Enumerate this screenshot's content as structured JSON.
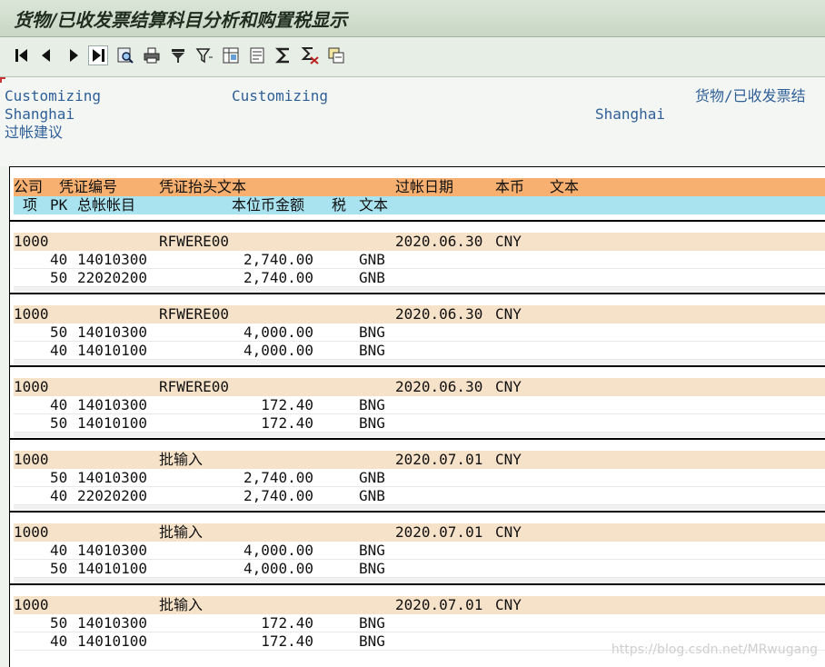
{
  "window": {
    "title": "货物/已收发票结算科目分析和购置税显示"
  },
  "toolbar": {
    "buttons": [
      {
        "icon": "first-page-icon"
      },
      {
        "icon": "previous-page-icon"
      },
      {
        "icon": "next-page-icon"
      },
      {
        "icon": "last-page-icon"
      },
      {
        "icon": "find-icon"
      },
      {
        "icon": "print-icon"
      },
      {
        "icon": "filter-icon"
      },
      {
        "icon": "funnel-icon"
      },
      {
        "icon": "choose-layout-icon"
      },
      {
        "icon": "save-layout-icon"
      },
      {
        "icon": "sum-icon"
      },
      {
        "icon": "subtotal-icon"
      },
      {
        "icon": "export-icon"
      }
    ]
  },
  "header": {
    "line1_left": "Customizing",
    "line1_mid": "Customizing",
    "line1_right": "货物/已收发票结",
    "line2_left": "Shanghai",
    "line2_right": "Shanghai",
    "line3_left": "过帐建议"
  },
  "columns": {
    "h1": {
      "company": "公司",
      "doc_no": "凭证编号",
      "header_text": "凭证抬头文本",
      "posting_date": "过帐日期",
      "currency": "本币",
      "text": "文本"
    },
    "h2": {
      "item": "项",
      "pk": "PK",
      "gl_account": "总帐帐目",
      "amount": "本位币金额",
      "tax": "税",
      "text": "文本"
    }
  },
  "documents": [
    {
      "company": "1000",
      "doc_no": "",
      "header_text": "RFWERE00",
      "posting_date": "2020.06.30",
      "currency": "CNY",
      "lines": [
        {
          "pk": "40",
          "account": "14010300",
          "amount": "2,740.00",
          "tax": "GNB"
        },
        {
          "pk": "50",
          "account": "22020200",
          "amount": "2,740.00",
          "tax": "GNB"
        }
      ]
    },
    {
      "company": "1000",
      "doc_no": "",
      "header_text": "RFWERE00",
      "posting_date": "2020.06.30",
      "currency": "CNY",
      "lines": [
        {
          "pk": "50",
          "account": "14010300",
          "amount": "4,000.00",
          "tax": "BNG"
        },
        {
          "pk": "40",
          "account": "14010100",
          "amount": "4,000.00",
          "tax": "BNG"
        }
      ]
    },
    {
      "company": "1000",
      "doc_no": "",
      "header_text": "RFWERE00",
      "posting_date": "2020.06.30",
      "currency": "CNY",
      "lines": [
        {
          "pk": "40",
          "account": "14010300",
          "amount": "172.40",
          "tax": "BNG"
        },
        {
          "pk": "50",
          "account": "14010100",
          "amount": "172.40",
          "tax": "BNG"
        }
      ]
    },
    {
      "company": "1000",
      "doc_no": "",
      "header_text": "批输入",
      "posting_date": "2020.07.01",
      "currency": "CNY",
      "lines": [
        {
          "pk": "50",
          "account": "14010300",
          "amount": "2,740.00",
          "tax": "GNB"
        },
        {
          "pk": "40",
          "account": "22020200",
          "amount": "2,740.00",
          "tax": "GNB"
        }
      ]
    },
    {
      "company": "1000",
      "doc_no": "",
      "header_text": "批输入",
      "posting_date": "2020.07.01",
      "currency": "CNY",
      "lines": [
        {
          "pk": "40",
          "account": "14010300",
          "amount": "4,000.00",
          "tax": "BNG"
        },
        {
          "pk": "50",
          "account": "14010100",
          "amount": "4,000.00",
          "tax": "BNG"
        }
      ]
    },
    {
      "company": "1000",
      "doc_no": "",
      "header_text": "批输入",
      "posting_date": "2020.07.01",
      "currency": "CNY",
      "lines": [
        {
          "pk": "50",
          "account": "14010300",
          "amount": "172.40",
          "tax": "BNG"
        },
        {
          "pk": "40",
          "account": "14010100",
          "amount": "172.40",
          "tax": "BNG"
        }
      ]
    }
  ],
  "watermark": "https://blog.csdn.net/MRwugang"
}
